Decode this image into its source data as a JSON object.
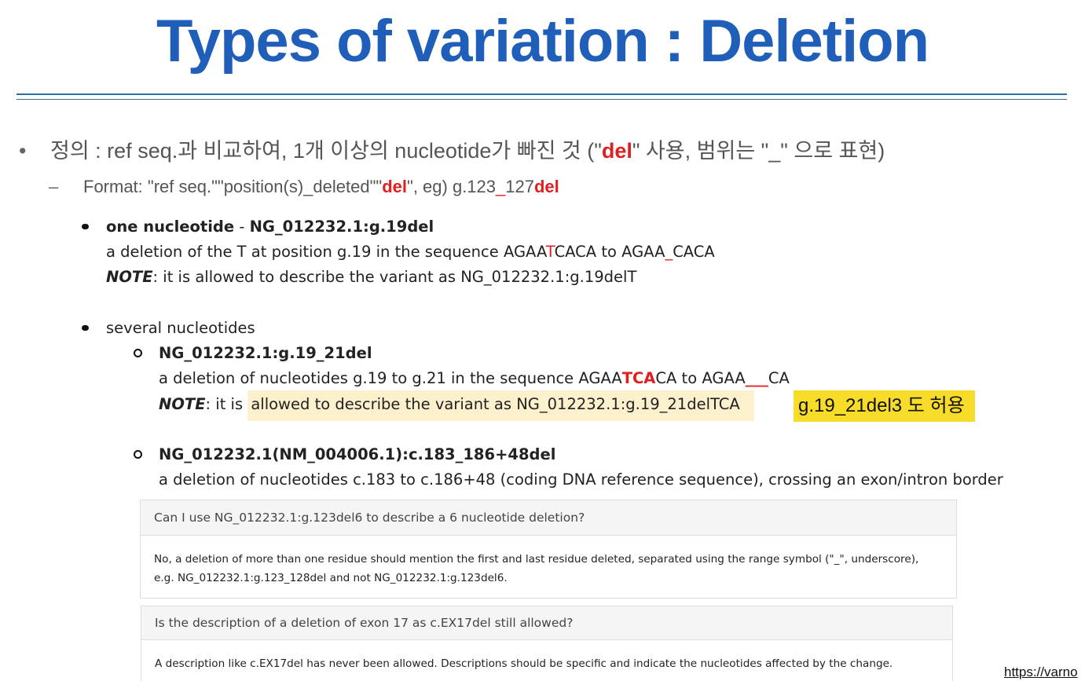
{
  "title": "Types of variation : Deletion",
  "definition": {
    "bullet": "•",
    "pre": "정의 : ref seq.과 비교하여, 1개 이상의 nucleotide가 빠진 것 (\"",
    "del": "del",
    "post": "\" 사용, 범위는 \"_\" 으로 표현)"
  },
  "format": {
    "dash": "–",
    "pre": "Format: \"ref seq.\"\"position(s)_deleted\"\"",
    "del": "del",
    "mid": "\", eg) g.123",
    "underscore": "_",
    "num": "127",
    "del2": "del"
  },
  "one": {
    "label": "one nucleotide",
    "sep": " - ",
    "code": "NG_012232.1:g.19del",
    "desc_pre": "a deletion of the T at position g.19 in the sequence AGAA",
    "desc_t": "T",
    "desc_post": "CACA to AGAA",
    "desc_us": "_",
    "desc_end": "CACA",
    "note_label": "NOTE",
    "note_text": ": it is allowed to describe the variant as NG_012232.1:g.19delT"
  },
  "several": {
    "label": "several nucleotides",
    "item1": {
      "code": "NG_012232.1:g.19_21del",
      "desc_pre": "a deletion of nucleotides g.19 to g.21 in the sequence AGAA",
      "desc_tca": "TCA",
      "desc_mid": "CA to AGAA",
      "desc_us": "___",
      "desc_end": "CA",
      "note_label": "NOTE",
      "note_pre": ": it is ",
      "note_hl": "allowed to describe the variant as NG_012232.1:g.19_21delTCA"
    },
    "tag": "g.19_21del3 도 허용",
    "item2": {
      "code": "NG_012232.1(NM_004006.1):c.183_186+48del",
      "desc": "a deletion of nucleotides c.183 to c.186+48 (coding DNA reference sequence), crossing an exon/intron border"
    }
  },
  "faq": [
    {
      "question": "Can I use NG_012232.1:g.123del6 to describe a 6 nucleotide deletion?",
      "answer_line1": "No, a deletion of more than one residue should mention the first and last residue deleted, separated using the range symbol (\"_\", underscore),",
      "answer_line2": "e.g. NG_012232.1:g.123_128del and not NG_012232.1:g.123del6."
    },
    {
      "question": "Is the description of a deletion of exon 17 as c.EX17del still allowed?",
      "answer_line1": "A description like c.EX17del has never been allowed. Descriptions should be specific and indicate the nucleotides affected by the change."
    }
  ],
  "footer_link": "https://varno"
}
